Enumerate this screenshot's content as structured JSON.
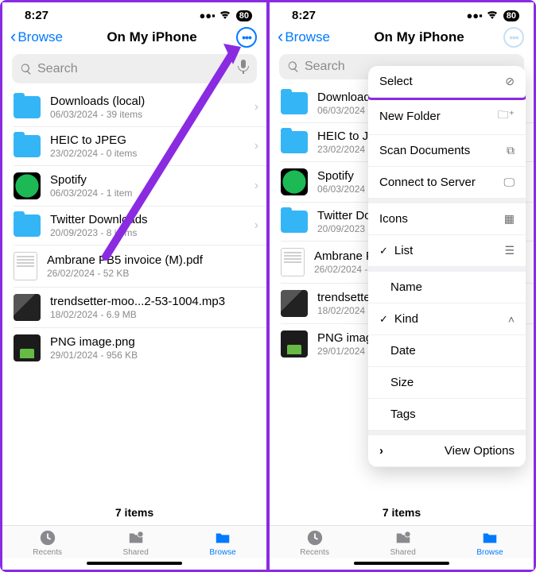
{
  "status": {
    "time": "8:27",
    "battery": "80"
  },
  "nav": {
    "back": "Browse",
    "title": "On My iPhone"
  },
  "search": {
    "placeholder": "Search"
  },
  "files": [
    {
      "name": "Downloads (local)",
      "sub": "06/03/2024 - 39 items",
      "kind": "folder"
    },
    {
      "name": "HEIC to JPEG",
      "sub": "23/02/2024 - 0 items",
      "kind": "folder"
    },
    {
      "name": "Spotify",
      "sub": "06/03/2024 - 1 item",
      "kind": "spotify"
    },
    {
      "name": "Twitter Downloads",
      "sub": "20/09/2023 - 8 items",
      "kind": "folder"
    },
    {
      "name": "Ambrane PB5 invoice (M).pdf",
      "sub": "26/02/2024 - 52 KB",
      "kind": "doc"
    },
    {
      "name": "trendsetter-moo...2-53-1004.mp3",
      "sub": "18/02/2024 - 6.9 MB",
      "kind": "audio"
    },
    {
      "name": "PNG image.png",
      "sub": "29/01/2024 - 956 KB",
      "kind": "png"
    }
  ],
  "count": "7 items",
  "tabs": {
    "recents": "Recents",
    "shared": "Shared",
    "browse": "Browse"
  },
  "menu": {
    "select": "Select",
    "newFolder": "New Folder",
    "scan": "Scan Documents",
    "connect": "Connect to Server",
    "icons": "Icons",
    "list": "List",
    "name": "Name",
    "kind": "Kind",
    "date": "Date",
    "size": "Size",
    "tags": "Tags",
    "viewOptions": "View Options"
  }
}
